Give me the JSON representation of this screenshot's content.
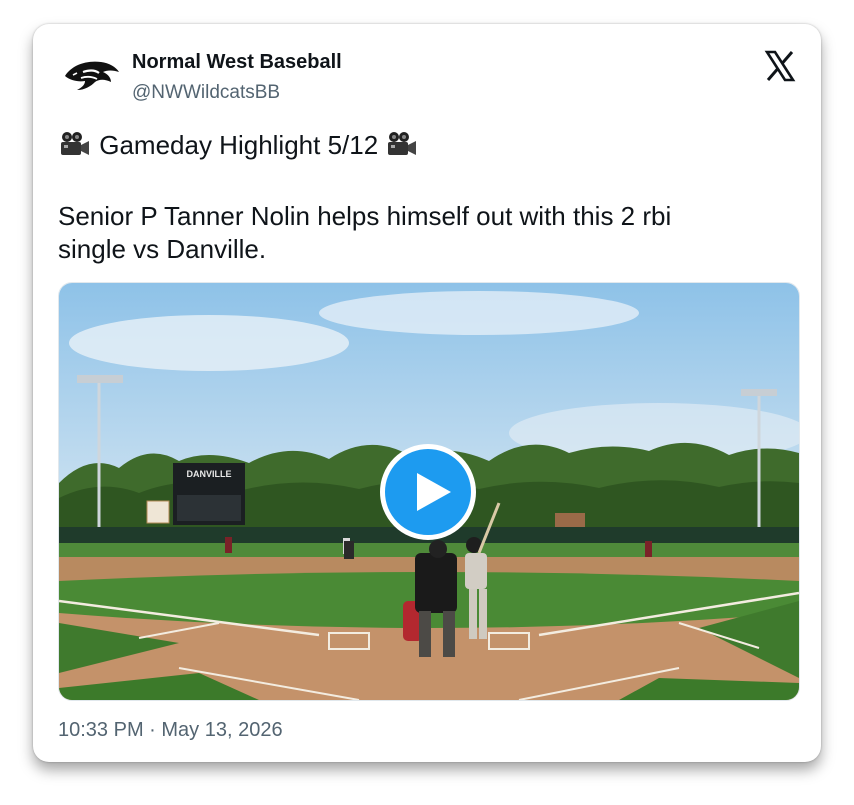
{
  "tweet": {
    "account_name": "Normal West Baseball",
    "handle": "@NWWildcatsBB",
    "headline": "Gameday Highlight 5/12",
    "body": "Senior P Tanner Nolin helps himself out with this 2 rbi\nsingle vs Danville.",
    "timestamp": "10:33 PM · May 13, 2026"
  },
  "media": {
    "scoreboard_text": "DANVILLE",
    "icons": [
      "wildcat-logo-icon",
      "x-logo-icon",
      "video-camera-icon",
      "play-icon"
    ]
  },
  "colors": {
    "play_button": "#1d9bf0",
    "text": "#0f1419",
    "secondary_text": "#536471"
  }
}
